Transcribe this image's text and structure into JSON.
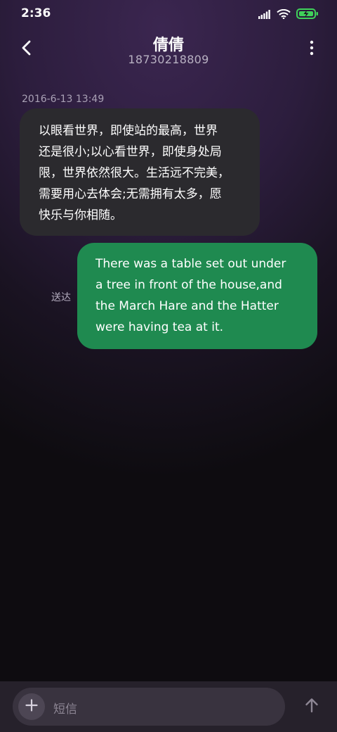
{
  "status_bar": {
    "time": "2:36",
    "icons": [
      "cellular-signal-icon",
      "wifi-icon",
      "battery-charging-icon"
    ],
    "battery_color": "#3fd15a"
  },
  "header": {
    "contact_name": "倩倩",
    "contact_number": "18730218809",
    "back_icon": "back-arrow-icon",
    "more_icon": "more-vertical-icon"
  },
  "conversation": {
    "timestamp": "2016-6-13 13:49",
    "messages": [
      {
        "direction": "incoming",
        "lines": [
          "以眼看世界，即使站的最高，世界",
          "还是很小;以心看世界，即使身处局",
          "限，世界依然很大。生活远不完美，",
          "需要用心去体会;无需拥有太多，愿",
          "快乐与你相随。"
        ],
        "bubble_color": "#2b2a2e"
      },
      {
        "direction": "outgoing",
        "lines": [
          "There was a table set out under",
          "a tree in front of the house,and",
          "the March Hare and the Hatter",
          "were having tea at it."
        ],
        "status": "送达",
        "bubble_color": "#1f8a50"
      }
    ]
  },
  "composer": {
    "placeholder": "短信",
    "add_icon": "plus-icon",
    "send_icon": "send-arrow-up-icon"
  }
}
